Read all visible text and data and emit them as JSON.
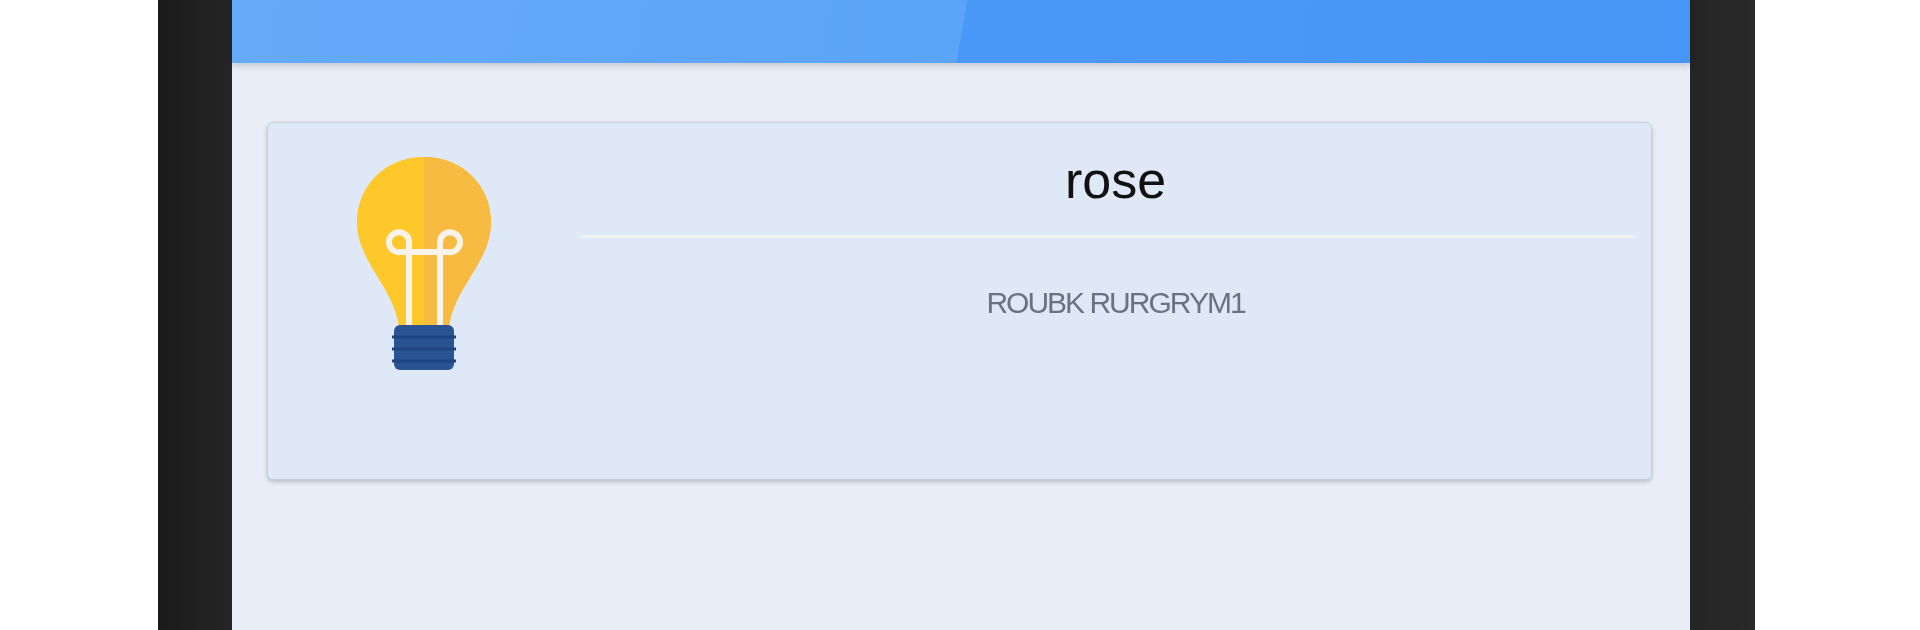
{
  "card": {
    "title": "rose",
    "subtitle": "ROUBK RURGRYM1"
  }
}
